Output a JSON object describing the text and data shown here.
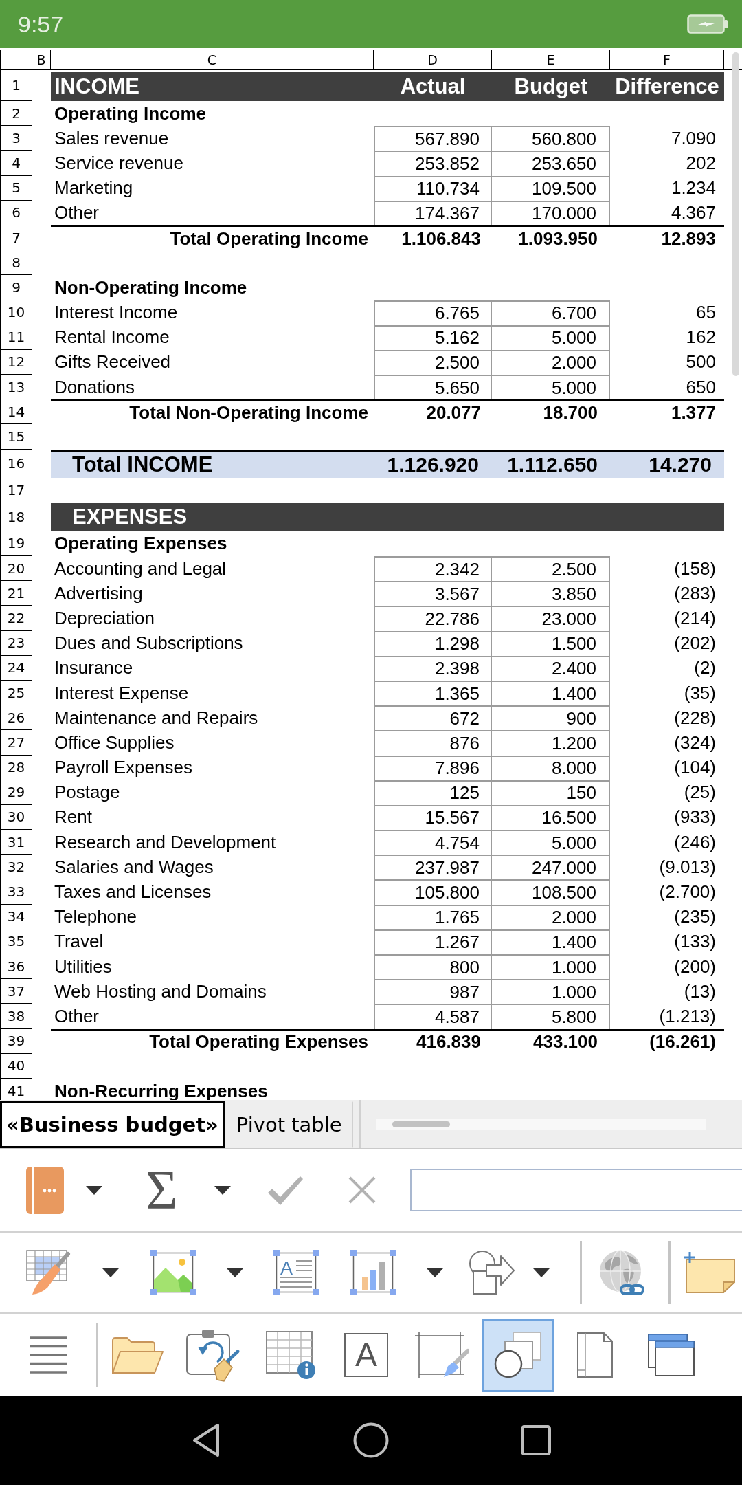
{
  "status_bar": {
    "time": "9:57"
  },
  "sheet": {
    "column_headers": [
      "B",
      "C",
      "D",
      "E",
      "F"
    ],
    "rows": [
      {
        "number": "1",
        "kind": "heading",
        "cells": [
          "INCOME",
          "Actual",
          "Budget",
          "Difference"
        ]
      },
      {
        "number": "2",
        "kind": "section",
        "cells": [
          "Operating Income"
        ]
      },
      {
        "number": "3",
        "kind": "item",
        "cells": [
          "Sales revenue",
          "567.890",
          "560.800",
          "7.090"
        ]
      },
      {
        "number": "4",
        "kind": "item",
        "cells": [
          "Service revenue",
          "253.852",
          "253.650",
          "202"
        ]
      },
      {
        "number": "5",
        "kind": "item",
        "cells": [
          "Marketing",
          "110.734",
          "109.500",
          "1.234"
        ]
      },
      {
        "number": "6",
        "kind": "item",
        "cells": [
          "Other",
          "174.367",
          "170.000",
          "4.367"
        ]
      },
      {
        "number": "7",
        "kind": "total",
        "cells": [
          "Total Operating Income",
          "1.106.843",
          "1.093.950",
          "12.893"
        ]
      },
      {
        "number": "8",
        "kind": "blank"
      },
      {
        "number": "9",
        "kind": "section",
        "cells": [
          "Non-Operating Income"
        ]
      },
      {
        "number": "10",
        "kind": "item",
        "cells": [
          "Interest Income",
          "6.765",
          "6.700",
          "65"
        ]
      },
      {
        "number": "11",
        "kind": "item",
        "cells": [
          "Rental Income",
          "5.162",
          "5.000",
          "162"
        ]
      },
      {
        "number": "12",
        "kind": "item",
        "cells": [
          "Gifts Received",
          "2.500",
          "2.000",
          "500"
        ]
      },
      {
        "number": "13",
        "kind": "item",
        "cells": [
          "Donations",
          "5.650",
          "5.000",
          "650"
        ]
      },
      {
        "number": "14",
        "kind": "total",
        "cells": [
          "Total Non-Operating Income",
          "20.077",
          "18.700",
          "1.377"
        ]
      },
      {
        "number": "15",
        "kind": "blank"
      },
      {
        "number": "16",
        "kind": "grand_total",
        "cells": [
          "Total INCOME",
          "1.126.920",
          "1.112.650",
          "14.270"
        ]
      },
      {
        "number": "17",
        "kind": "blank"
      },
      {
        "number": "18",
        "kind": "band",
        "cells": [
          "EXPENSES"
        ]
      },
      {
        "number": "19",
        "kind": "section",
        "cells": [
          "Operating Expenses"
        ]
      },
      {
        "number": "20",
        "kind": "item",
        "cells": [
          "Accounting and Legal",
          "2.342",
          "2.500",
          "(158)"
        ]
      },
      {
        "number": "21",
        "kind": "item",
        "cells": [
          "Advertising",
          "3.567",
          "3.850",
          "(283)"
        ]
      },
      {
        "number": "22",
        "kind": "item",
        "cells": [
          "Depreciation",
          "22.786",
          "23.000",
          "(214)"
        ]
      },
      {
        "number": "23",
        "kind": "item",
        "cells": [
          "Dues and Subscriptions",
          "1.298",
          "1.500",
          "(202)"
        ]
      },
      {
        "number": "24",
        "kind": "item",
        "cells": [
          "Insurance",
          "2.398",
          "2.400",
          "(2)"
        ]
      },
      {
        "number": "25",
        "kind": "item",
        "cells": [
          "Interest Expense",
          "1.365",
          "1.400",
          "(35)"
        ]
      },
      {
        "number": "26",
        "kind": "item",
        "cells": [
          "Maintenance and Repairs",
          "672",
          "900",
          "(228)"
        ]
      },
      {
        "number": "27",
        "kind": "item",
        "cells": [
          "Office Supplies",
          "876",
          "1.200",
          "(324)"
        ]
      },
      {
        "number": "28",
        "kind": "item",
        "cells": [
          "Payroll Expenses",
          "7.896",
          "8.000",
          "(104)"
        ]
      },
      {
        "number": "29",
        "kind": "item",
        "cells": [
          "Postage",
          "125",
          "150",
          "(25)"
        ]
      },
      {
        "number": "30",
        "kind": "item",
        "cells": [
          "Rent",
          "15.567",
          "16.500",
          "(933)"
        ]
      },
      {
        "number": "31",
        "kind": "item",
        "cells": [
          "Research and Development",
          "4.754",
          "5.000",
          "(246)"
        ]
      },
      {
        "number": "32",
        "kind": "item",
        "cells": [
          "Salaries and Wages",
          "237.987",
          "247.000",
          "(9.013)"
        ]
      },
      {
        "number": "33",
        "kind": "item",
        "cells": [
          "Taxes and Licenses",
          "105.800",
          "108.500",
          "(2.700)"
        ]
      },
      {
        "number": "34",
        "kind": "item",
        "cells": [
          "Telephone",
          "1.765",
          "2.000",
          "(235)"
        ]
      },
      {
        "number": "35",
        "kind": "item",
        "cells": [
          "Travel",
          "1.267",
          "1.400",
          "(133)"
        ]
      },
      {
        "number": "36",
        "kind": "item",
        "cells": [
          "Utilities",
          "800",
          "1.000",
          "(200)"
        ]
      },
      {
        "number": "37",
        "kind": "item",
        "cells": [
          "Web Hosting and Domains",
          "987",
          "1.000",
          "(13)"
        ]
      },
      {
        "number": "38",
        "kind": "item",
        "cells": [
          "Other",
          "4.587",
          "5.800",
          "(1.213)"
        ]
      },
      {
        "number": "39",
        "kind": "total",
        "cells": [
          "Total Operating Expenses",
          "416.839",
          "433.100",
          "(16.261)"
        ]
      },
      {
        "number": "40",
        "kind": "blank"
      },
      {
        "number": "41",
        "kind": "section",
        "cells": [
          "Non-Recurring Expenses"
        ]
      }
    ]
  },
  "sheet_tabs": [
    {
      "label": "«Business budget»",
      "selected": true
    },
    {
      "label": "Pivot table",
      "selected": false
    }
  ],
  "formula_bar": {
    "cell_menu": {
      "dropdown": true
    },
    "function": {
      "glyph": "Σ",
      "dropdown": true
    },
    "accept": {
      "disabled": true
    },
    "cancel": {
      "disabled": true
    }
  },
  "insert_toolbar": [
    {
      "dropdown": true
    },
    {
      "dropdown": true
    },
    {
      "glyph": "A",
      "dropdown": false
    },
    {
      "dropdown": true
    },
    {
      "dropdown": true
    },
    {
      "dropdown": false
    },
    {
      "dropdown": false
    }
  ],
  "main_toolbar": [
    {
      "selected": false
    },
    {
      "selected": false
    },
    {
      "selected": false
    },
    {
      "selected": false
    },
    {
      "glyph": "A",
      "selected": false
    },
    {
      "selected": false
    },
    {
      "selected": true
    },
    {
      "selected": false
    },
    {
      "selected": false
    }
  ]
}
